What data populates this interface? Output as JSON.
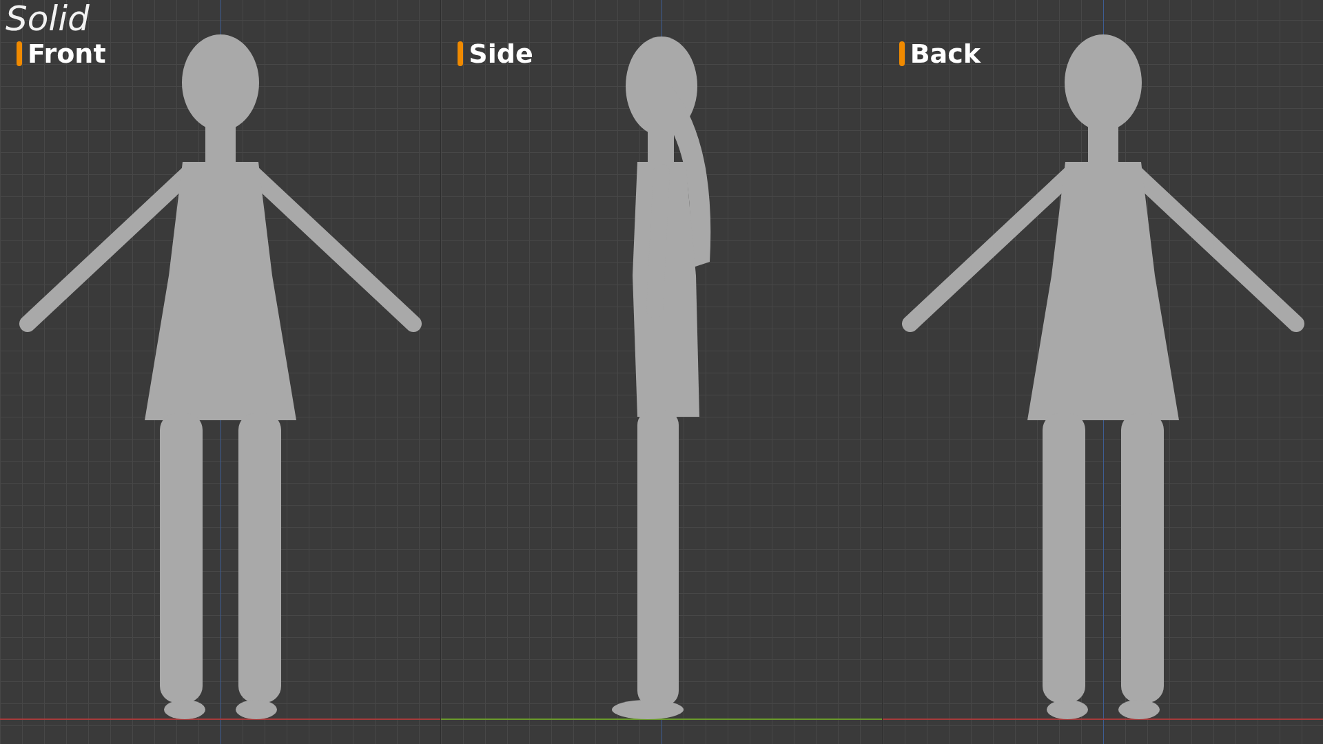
{
  "mode_label": "Solid",
  "views": [
    {
      "label": "Front",
      "kind": "front"
    },
    {
      "label": "Side",
      "kind": "side"
    },
    {
      "label": "Back",
      "kind": "back"
    }
  ]
}
